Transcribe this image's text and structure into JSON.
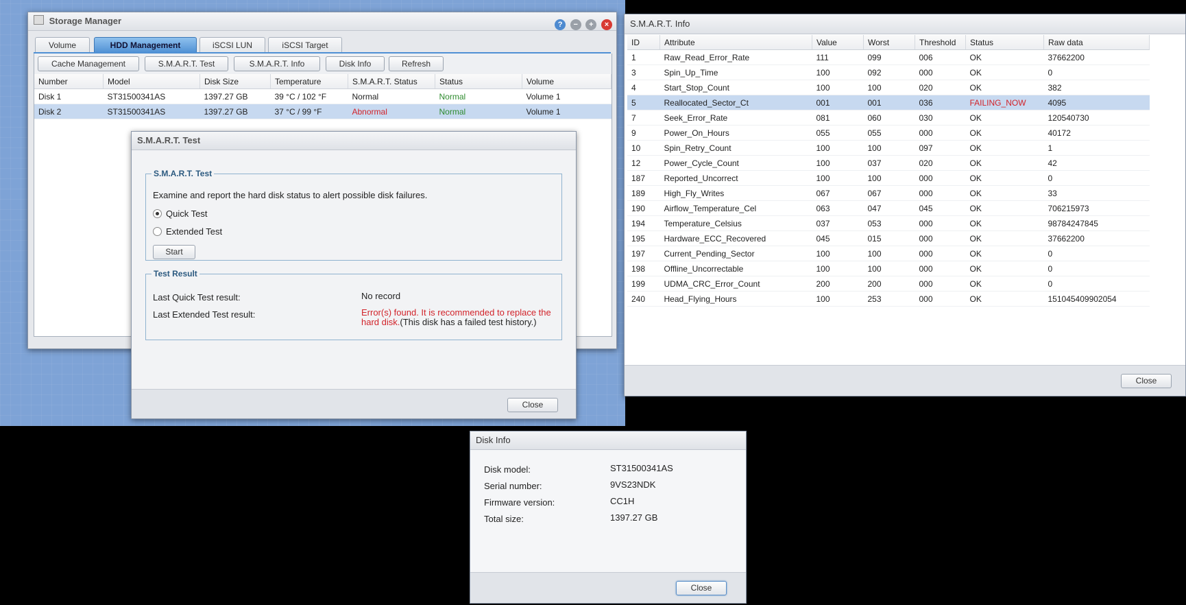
{
  "storage_manager": {
    "title": "Storage Manager",
    "window_controls": [
      "?",
      "−",
      "+",
      "×"
    ],
    "tabs": [
      "Volume",
      "HDD Management",
      "iSCSI LUN",
      "iSCSI Target"
    ],
    "active_tab": "HDD Management",
    "toolbar": [
      "Cache Management",
      "S.M.A.R.T. Test",
      "S.M.A.R.T. Info",
      "Disk Info",
      "Refresh"
    ],
    "columns": [
      "Number",
      "Model",
      "Disk Size",
      "Temperature",
      "S.M.A.R.T. Status",
      "Status",
      "Volume"
    ],
    "rows": [
      {
        "number": "Disk 1",
        "model": "ST31500341AS",
        "size": "1397.27 GB",
        "temp": "39 °C / 102 °F",
        "smart": "Normal",
        "status": "Normal",
        "volume": "Volume 1"
      },
      {
        "number": "Disk 2",
        "model": "ST31500341AS",
        "size": "1397.27 GB",
        "temp": "37 °C / 99 °F",
        "smart": "Abnormal",
        "status": "Normal",
        "volume": "Volume 1"
      }
    ]
  },
  "smart_test": {
    "title": "S.M.A.R.T. Test",
    "section_title": "S.M.A.R.T. Test",
    "description": "Examine and report the hard disk status to alert possible disk failures.",
    "quick_test": "Quick Test",
    "extended_test": "Extended Test",
    "start": "Start",
    "result_title": "Test Result",
    "last_quick_label": "Last Quick Test result:",
    "last_quick_value": "No record",
    "last_extended_label": "Last Extended Test result:",
    "last_extended_error": "Error(s) found. It is recommended to replace the hard disk.",
    "last_extended_note": "(This disk has a failed test history.)",
    "close": "Close"
  },
  "smart_info": {
    "title": "S.M.A.R.T. Info",
    "columns": [
      "ID",
      "Attribute",
      "Value",
      "Worst",
      "Threshold",
      "Status",
      "Raw data"
    ],
    "rows": [
      [
        "1",
        "Raw_Read_Error_Rate",
        "111",
        "099",
        "006",
        "OK",
        "37662200"
      ],
      [
        "3",
        "Spin_Up_Time",
        "100",
        "092",
        "000",
        "OK",
        "0"
      ],
      [
        "4",
        "Start_Stop_Count",
        "100",
        "100",
        "020",
        "OK",
        "382"
      ],
      [
        "5",
        "Reallocated_Sector_Ct",
        "001",
        "001",
        "036",
        "FAILING_NOW",
        "4095"
      ],
      [
        "7",
        "Seek_Error_Rate",
        "081",
        "060",
        "030",
        "OK",
        "120540730"
      ],
      [
        "9",
        "Power_On_Hours",
        "055",
        "055",
        "000",
        "OK",
        "40172"
      ],
      [
        "10",
        "Spin_Retry_Count",
        "100",
        "100",
        "097",
        "OK",
        "1"
      ],
      [
        "12",
        "Power_Cycle_Count",
        "100",
        "037",
        "020",
        "OK",
        "42"
      ],
      [
        "187",
        "Reported_Uncorrect",
        "100",
        "100",
        "000",
        "OK",
        "0"
      ],
      [
        "189",
        "High_Fly_Writes",
        "067",
        "067",
        "000",
        "OK",
        "33"
      ],
      [
        "190",
        "Airflow_Temperature_Cel",
        "063",
        "047",
        "045",
        "OK",
        "706215973"
      ],
      [
        "194",
        "Temperature_Celsius",
        "037",
        "053",
        "000",
        "OK",
        "98784247845"
      ],
      [
        "195",
        "Hardware_ECC_Recovered",
        "045",
        "015",
        "000",
        "OK",
        "37662200"
      ],
      [
        "197",
        "Current_Pending_Sector",
        "100",
        "100",
        "000",
        "OK",
        "0"
      ],
      [
        "198",
        "Offline_Uncorrectable",
        "100",
        "100",
        "000",
        "OK",
        "0"
      ],
      [
        "199",
        "UDMA_CRC_Error_Count",
        "200",
        "200",
        "000",
        "OK",
        "0"
      ],
      [
        "240",
        "Head_Flying_Hours",
        "100",
        "253",
        "000",
        "OK",
        "151045409902054"
      ]
    ],
    "close": "Close"
  },
  "disk_info": {
    "title": "Disk Info",
    "fields": [
      {
        "label": "Disk model:",
        "value": "ST31500341AS"
      },
      {
        "label": "Serial number:",
        "value": "9VS23NDK"
      },
      {
        "label": "Firmware version:",
        "value": "CC1H"
      },
      {
        "label": "Total size:",
        "value": "1397.27 GB"
      }
    ],
    "close": "Close"
  },
  "colors": {
    "tab_active": "#4f90d4",
    "ok_green": "#2e8b2e",
    "error_red": "#d2232a",
    "selection": "#c7d9f0"
  }
}
